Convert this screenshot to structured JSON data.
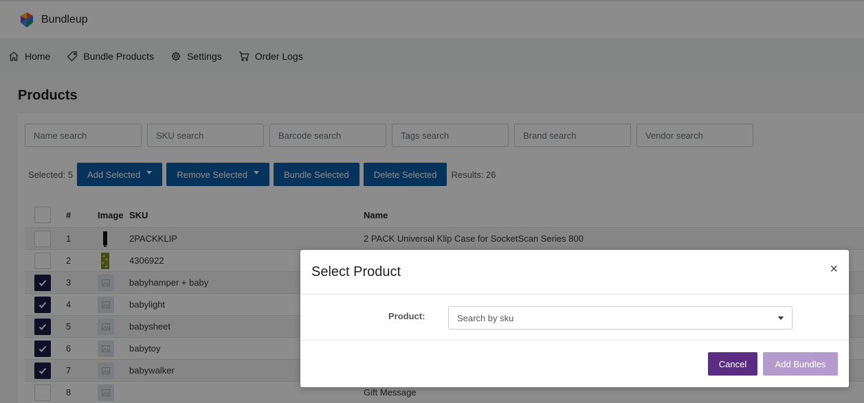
{
  "app": {
    "name": "Bundleup"
  },
  "nav": {
    "items": [
      {
        "label": "Home",
        "icon": "home-icon"
      },
      {
        "label": "Bundle Products",
        "icon": "tag-icon"
      },
      {
        "label": "Settings",
        "icon": "gear-icon"
      },
      {
        "label": "Order Logs",
        "icon": "cart-icon"
      }
    ]
  },
  "page": {
    "title": "Products"
  },
  "search": {
    "name_placeholder": "Name search",
    "sku_placeholder": "SKU search",
    "barcode_placeholder": "Barcode search",
    "tags_placeholder": "Tags search",
    "brand_placeholder": "Brand search",
    "vendor_placeholder": "Vendor search"
  },
  "actions": {
    "selected_label": "Selected: 5",
    "add_selected": "Add Selected",
    "remove_selected": "Remove Selected",
    "bundle_selected": "Bundle Selected",
    "delete_selected": "Delete Selected",
    "results_label": "Results: 26"
  },
  "table": {
    "headers": {
      "num": "#",
      "image": "Image",
      "sku": "SKU",
      "name": "Name"
    },
    "rows": [
      {
        "num": "1",
        "sku": "2PACKKLIP",
        "name": "2 PACK Universal Klip Case for SocketScan Series 800",
        "checked": false
      },
      {
        "num": "2",
        "sku": "4306922",
        "name": "",
        "checked": false
      },
      {
        "num": "3",
        "sku": "babyhamper + baby",
        "name": "",
        "checked": true
      },
      {
        "num": "4",
        "sku": "babylight",
        "name": "",
        "checked": true
      },
      {
        "num": "5",
        "sku": "babysheet",
        "name": "",
        "checked": true
      },
      {
        "num": "6",
        "sku": "babytoy",
        "name": "",
        "checked": true
      },
      {
        "num": "7",
        "sku": "babywalker",
        "name": "",
        "checked": true
      },
      {
        "num": "8",
        "sku": "",
        "name": "Gift Message",
        "checked": false
      }
    ]
  },
  "modal": {
    "title": "Select Product",
    "close_glyph": "×",
    "product_label": "Product:",
    "product_placeholder": "Search by sku",
    "cancel": "Cancel",
    "add_bundles": "Add Bundles"
  },
  "colors": {
    "primary_blue": "#0b5ea8",
    "purple": "#5a2d82",
    "purple_disabled": "#b39ccd",
    "checkbox_checked": "#1e1d47"
  }
}
